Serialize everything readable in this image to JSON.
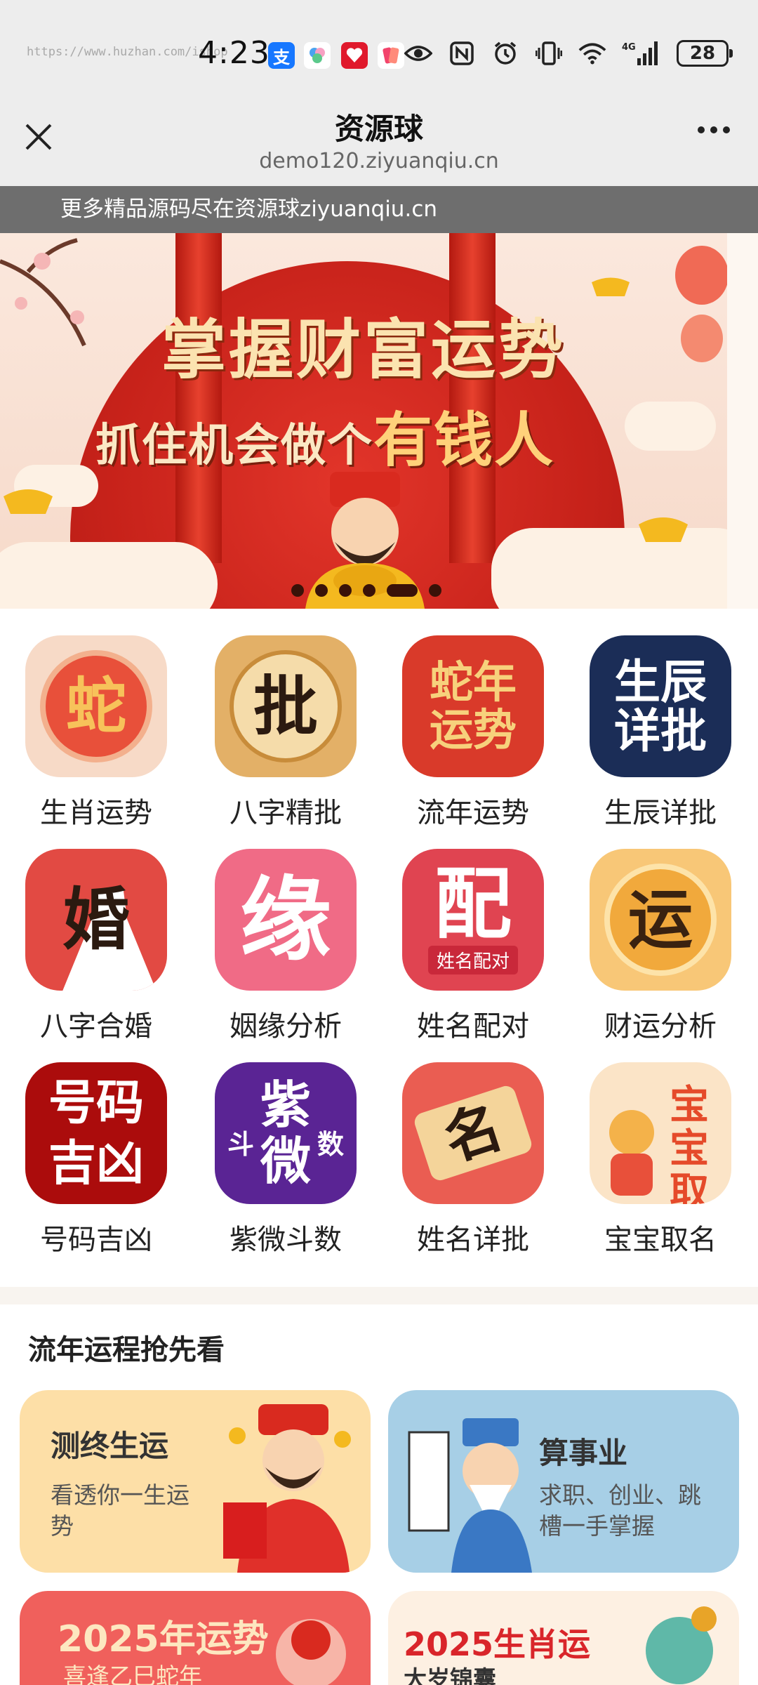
{
  "status_bar": {
    "url_text": "https://www.huzhan.com/ishop",
    "time": "4:23",
    "apps": [
      "支",
      "",
      "",
      ""
    ],
    "battery": "28",
    "network": "4G"
  },
  "nav": {
    "title": "资源球",
    "subtitle": "demo120.ziyuanqiu.cn"
  },
  "notice": "更多精品源码尽在资源球ziyuanqiu.cn",
  "banner": {
    "line1": "掌握财富运势",
    "line2_a": "抓住机会做个",
    "line2_b": "有钱人",
    "slides": 6,
    "active_slide": 4
  },
  "grid": [
    {
      "label": "生肖运势",
      "glyph": "蛇",
      "color": "#e8503a",
      "bg": "#f7dac7"
    },
    {
      "label": "八字精批",
      "glyph": "批",
      "color": "#2b1a10",
      "bg": "#e3b067"
    },
    {
      "label": "流年运势",
      "glyph": "蛇年运势",
      "color": "#f7d17c",
      "bg": "#d93a2a"
    },
    {
      "label": "生辰详批",
      "glyph": "生辰详批",
      "color": "#ffffff",
      "bg": "#1b2d57"
    },
    {
      "label": "八字合婚",
      "glyph": "婚",
      "color": "#2b1a10",
      "bg": "#e24a43"
    },
    {
      "label": "姻缘分析",
      "glyph": "缘",
      "color": "#ffffff",
      "bg": "#f06b86"
    },
    {
      "label": "姓名配对",
      "glyph": "配",
      "color": "#ffffff",
      "bg": "#e04451"
    },
    {
      "label": "财运分析",
      "glyph": "运",
      "color": "#3a2210",
      "bg": "#f8c777"
    },
    {
      "label": "号码吉凶",
      "glyph": "号码吉凶",
      "color": "#ffffff",
      "bg": "#ab0c0c"
    },
    {
      "label": "紫微斗数",
      "glyph": "紫微",
      "color": "#ffffff",
      "bg": "#5a2494"
    },
    {
      "label": "姓名详批",
      "glyph": "名",
      "color": "#2b1a10",
      "bg": "#ea5d52"
    },
    {
      "label": "宝宝取名",
      "glyph": "宝宝取名",
      "color": "#e54a2a",
      "bg": "#fbe4c7"
    }
  ],
  "tile_sub": {
    "pei": "姓名配对",
    "ziwei_left": "斗",
    "ziwei_right": "数"
  },
  "section": {
    "title": "流年运程抢先看",
    "cards": [
      {
        "title": "测终生运",
        "desc": "看透你一生运势",
        "bg": "#fddfa7"
      },
      {
        "title": "算事业",
        "desc": "求职、创业、跳槽一手掌握",
        "bg": "#a7cfe6"
      },
      {
        "title": "2025年运势",
        "desc": "喜逢乙巳蛇年",
        "bg": "#f0605c"
      },
      {
        "title": "2025生肖运",
        "desc": "大岁锦囊",
        "bg": "#fdf0e2"
      }
    ]
  }
}
